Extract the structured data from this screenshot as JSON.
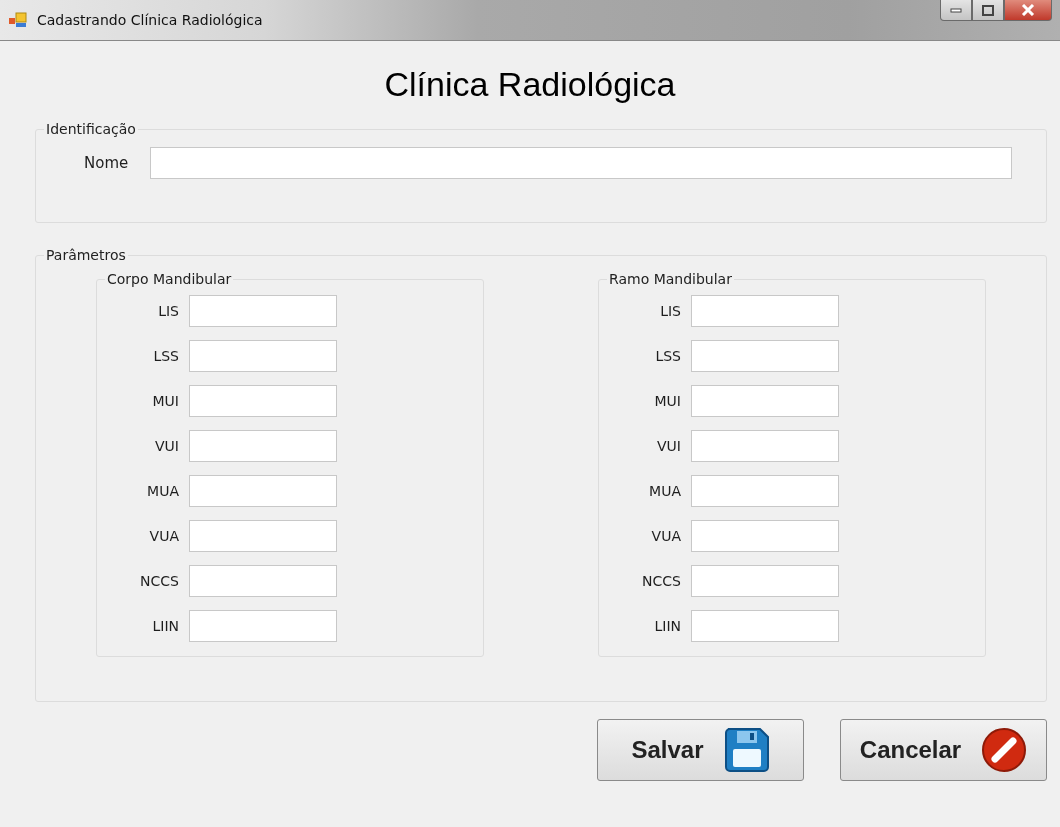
{
  "window": {
    "title": "Cadastrando Clínica Radiológica"
  },
  "heading": "Clínica Radiológica",
  "identification": {
    "legend": "Identificação",
    "label": "Nome"
  },
  "parameters": {
    "legend": "Parâmetros",
    "groups": [
      {
        "legend": "Corpo Mandibular",
        "fields": [
          "LIS",
          "LSS",
          "MUI",
          "VUI",
          "MUA",
          "VUA",
          "NCCS",
          "LIIN"
        ]
      },
      {
        "legend": "Ramo Mandibular",
        "fields": [
          "LIS",
          "LSS",
          "MUI",
          "VUI",
          "MUA",
          "VUA",
          "NCCS",
          "LIIN"
        ]
      }
    ]
  },
  "buttons": [
    {
      "label": "Salvar",
      "kind": "save"
    },
    {
      "label": "Cancelar",
      "kind": "cancel"
    }
  ]
}
